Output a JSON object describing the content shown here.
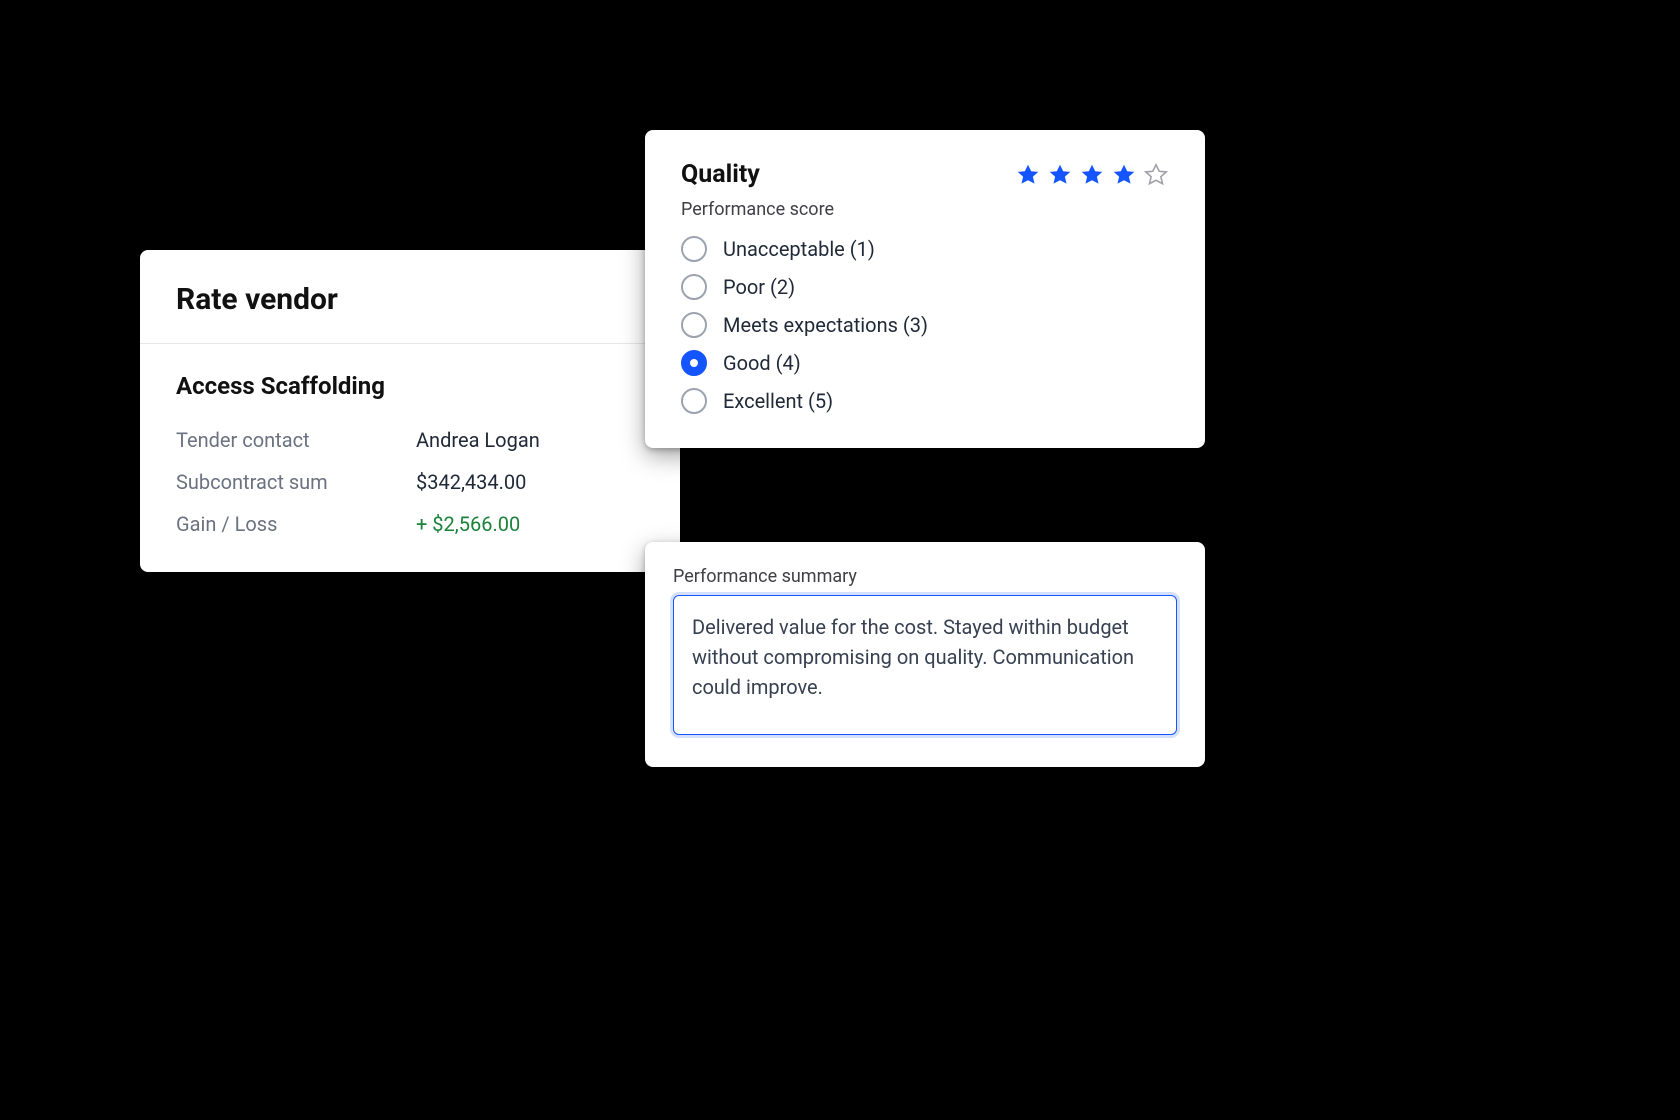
{
  "vendor_card": {
    "title": "Rate vendor",
    "vendor_name": "Access Scaffolding",
    "rows": [
      {
        "label": "Tender contact",
        "value": "Andrea Logan",
        "style": ""
      },
      {
        "label": "Subcontract sum",
        "value": "$342,434.00",
        "style": ""
      },
      {
        "label": "Gain / Loss",
        "value": "+ $2,566.00",
        "style": "positive"
      }
    ]
  },
  "quality_card": {
    "title": "Quality",
    "subtitle": "Performance score",
    "stars_filled": 4,
    "stars_total": 5,
    "options": [
      {
        "label": "Unacceptable (1)",
        "selected": false
      },
      {
        "label": "Poor (2)",
        "selected": false
      },
      {
        "label": "Meets expectations (3)",
        "selected": false
      },
      {
        "label": "Good (4)",
        "selected": true
      },
      {
        "label": "Excellent (5)",
        "selected": false
      }
    ]
  },
  "summary_card": {
    "label": "Performance summary",
    "value": "Delivered value for the cost. Stayed within budget without compromising on quality. Communication could improve."
  }
}
